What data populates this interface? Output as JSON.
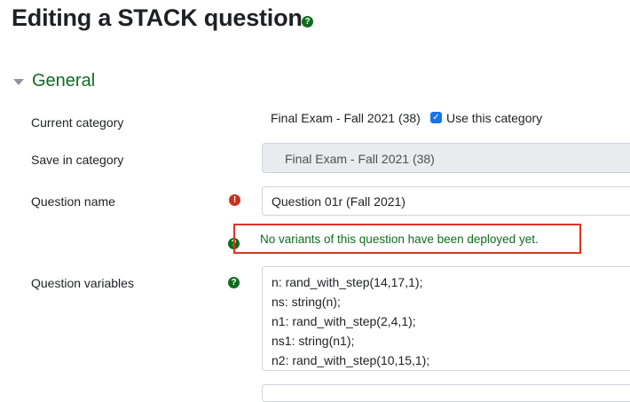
{
  "page": {
    "title": "Editing a STACK question"
  },
  "section": {
    "title": "General"
  },
  "form": {
    "current_category": {
      "label": "Current category",
      "value": "Final Exam - Fall 2021 (38)",
      "checkbox_label": "Use this category",
      "checked": true
    },
    "save_in_category": {
      "label": "Save in category",
      "value": "Final Exam - Fall 2021 (38)"
    },
    "question_name": {
      "label": "Question name",
      "value": "Question 01r (Fall 2021)"
    },
    "notice": "No variants of this question have been deployed yet.",
    "question_variables": {
      "label": "Question variables",
      "lines": [
        "n: rand_with_step(14,17,1);",
        "ns: string(n);",
        "n1: rand_with_step(2,4,1);",
        "ns1: string(n1);",
        "n2: rand_with_step(10,15,1);"
      ]
    }
  },
  "icons": {
    "help": "help-icon",
    "required": "required-icon",
    "caret": "caret-down-icon",
    "check": "checkmark-icon"
  },
  "colors": {
    "accent_green": "#0f6c1f",
    "required_red": "#ca3120",
    "highlight_border": "#e0321f",
    "checkbox_blue": "#1a73e8"
  }
}
